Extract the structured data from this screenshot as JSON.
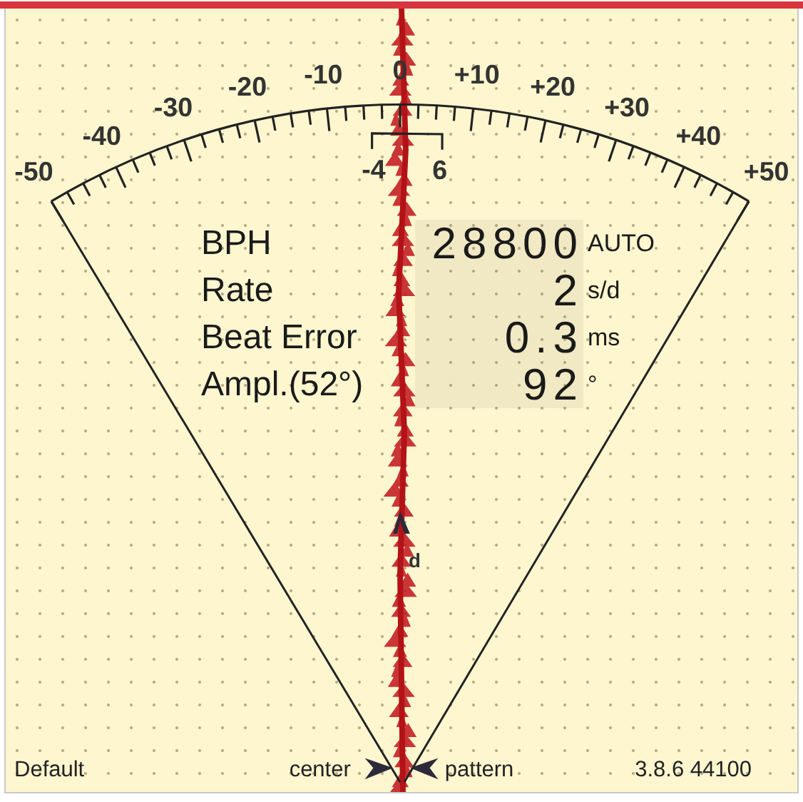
{
  "scale": {
    "labels": [
      "-50",
      "-40",
      "-30",
      "-20",
      "-10",
      "0",
      "+10",
      "+20",
      "+30",
      "+40",
      "+50"
    ]
  },
  "range": {
    "low": "-4",
    "high": "6"
  },
  "readings": [
    {
      "label": "BPH",
      "value": "28800",
      "unit": "AUTO"
    },
    {
      "label": "Rate",
      "value": "2",
      "unit": "s/d"
    },
    {
      "label": "Beat Error",
      "value": "0.3",
      "unit": "ms"
    },
    {
      "label": "Ampl.(52°)",
      "value": "92",
      "unit": "°"
    }
  ],
  "pointer_label": "d",
  "footer": {
    "left": "Default",
    "center_left": "center",
    "center_right": "pattern",
    "right": "3.8.6 44100"
  }
}
